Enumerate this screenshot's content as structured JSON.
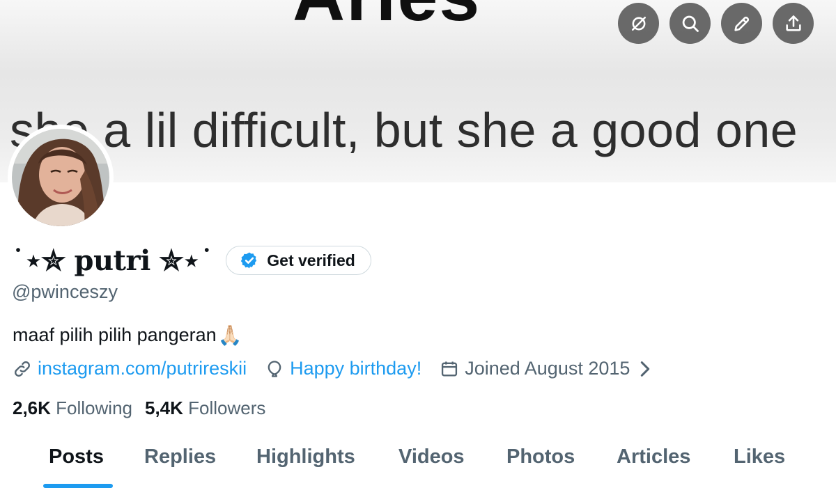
{
  "banner": {
    "title": "Aries",
    "quote": "she a lil difficult, but she a good one"
  },
  "top_actions": [
    {
      "icon": "hide-icon",
      "name": "hide-button"
    },
    {
      "icon": "search-icon",
      "name": "search-button"
    },
    {
      "icon": "edit-icon",
      "name": "edit-button"
    },
    {
      "icon": "share-icon",
      "name": "share-button"
    }
  ],
  "profile": {
    "display_name": "˙⋆✮ putri ✮⋆˙",
    "handle": "@pwinceszy",
    "bio": "maaf pilih pilih pangeran",
    "bio_emoji": "🙏🏻",
    "verify_label": "Get verified"
  },
  "meta": {
    "link": "instagram.com/putrireskii",
    "birthday": "Happy birthday!",
    "joined": "Joined August 2015"
  },
  "stats": {
    "following_count": "2,6K",
    "following_label": "Following",
    "followers_count": "5,4K",
    "followers_label": "Followers"
  },
  "tabs": [
    "Posts",
    "Replies",
    "Highlights",
    "Videos",
    "Photos",
    "Articles",
    "Likes"
  ],
  "active_tab": "Posts",
  "colors": {
    "accent": "#1d9bf0",
    "text_primary": "#0f1419",
    "text_secondary": "#536471",
    "border": "#cfd9de"
  }
}
